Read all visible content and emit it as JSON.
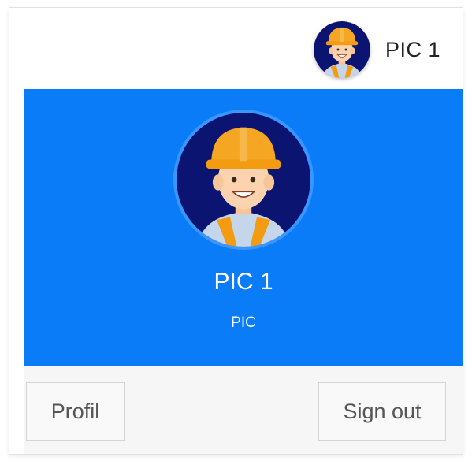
{
  "navbar": {
    "user_name": "PIC 1",
    "avatar_icon": "worker-avatar-icon"
  },
  "user_header": {
    "name": "PIC 1",
    "role": "PIC",
    "avatar_icon": "worker-avatar-icon",
    "background_color": "#0a7cf7"
  },
  "user_footer": {
    "profile_label": "Profil",
    "signout_label": "Sign out"
  }
}
